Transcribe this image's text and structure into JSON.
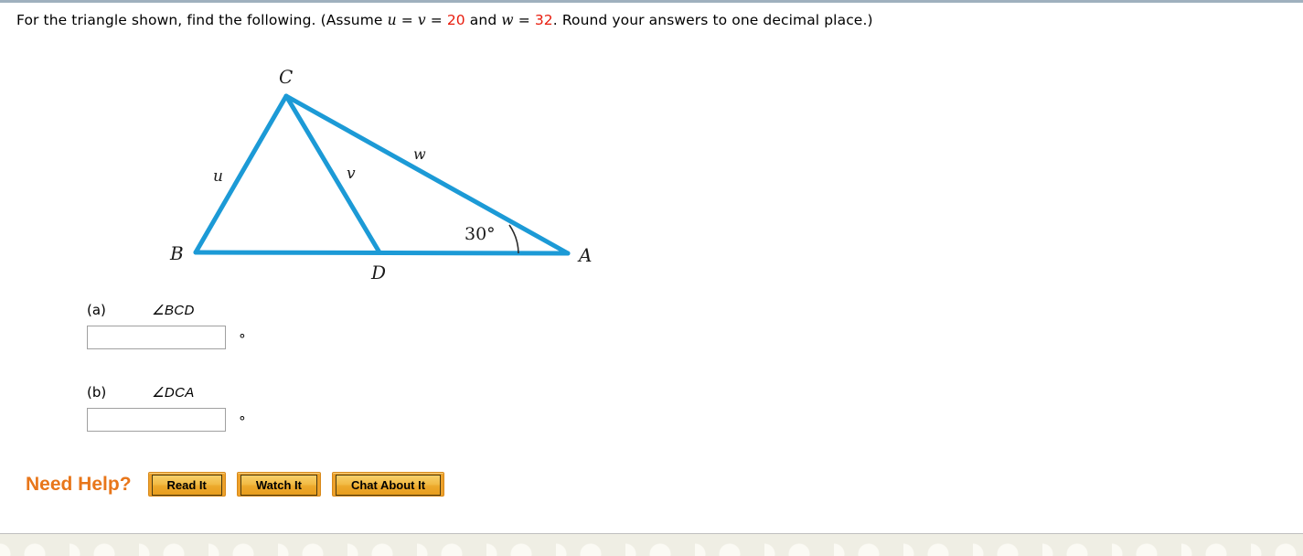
{
  "question": {
    "prefix": "For the triangle shown, find the following. (Assume ",
    "var_u": "u",
    "eq1": " = ",
    "var_v": "v",
    "eq2": " = ",
    "value_uv": "20",
    "conj": " and ",
    "var_w": "w",
    "eq3": " = ",
    "value_w": "32",
    "suffix": ". Round your answers to one decimal place.)"
  },
  "figure": {
    "vertex_b": "B",
    "vertex_c": "C",
    "vertex_d": "D",
    "vertex_a": "A",
    "side_u": "u",
    "side_v": "v",
    "side_w": "w",
    "angle_a": "30°",
    "line_color": "#1c9ad6"
  },
  "answers": {
    "parts": [
      {
        "label": "(a)",
        "expression": "∠BCD",
        "value": "",
        "placeholder": "",
        "unit": "°"
      },
      {
        "label": "(b)",
        "expression": "∠DCA",
        "value": "",
        "placeholder": "",
        "unit": "°"
      }
    ]
  },
  "need_help": {
    "label": "Need Help?",
    "buttons": [
      {
        "label": "Read It",
        "name": "read-it"
      },
      {
        "label": "Watch It",
        "name": "watch-it"
      },
      {
        "label": "Chat About It",
        "name": "chat-about-it"
      }
    ],
    "accent_color": "#e8761a"
  }
}
